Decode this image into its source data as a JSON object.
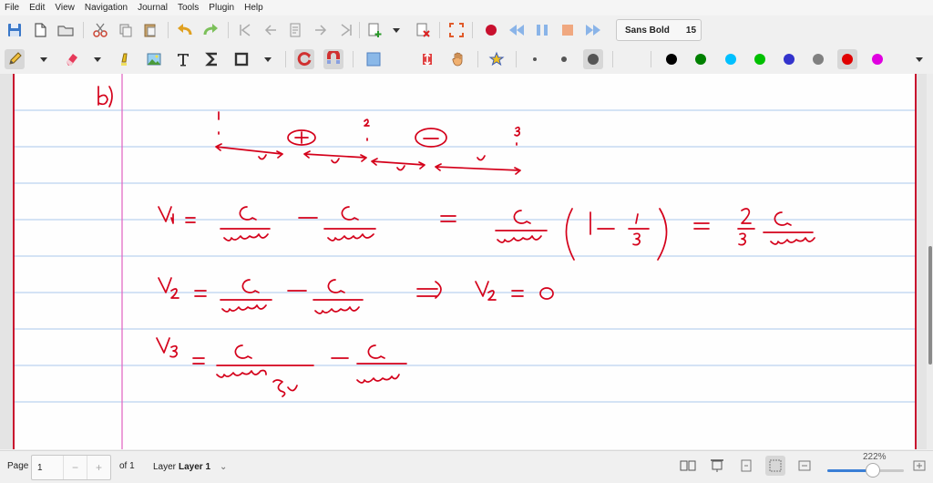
{
  "menu": [
    "File",
    "Edit",
    "View",
    "Navigation",
    "Journal",
    "Tools",
    "Plugin",
    "Help"
  ],
  "font_selector": {
    "name": "Sans Bold",
    "size": "15"
  },
  "colors": {
    "pen_palette": [
      "#000000",
      "#008000",
      "#00c0ff",
      "#00c000",
      "#3333cc",
      "#808080",
      "#e00000",
      "#e000e0"
    ],
    "ink": "#d4001a",
    "rule_line": "#a9c8ec",
    "margin_line": "#c8102e"
  },
  "notes": {
    "part": "b)",
    "eq1": "V₁ = Q/(4πε₀ r) − Q/(4πε₀ 3r) = Q/(4πε₀ r)(1 − 1/3) = 2/3 · Q/(4πε₀ r)",
    "eq2": "V₂ = Q/(4πε₀ r) − Q/(4πε₀ r) ⇒ V₂ = 0",
    "eq3": "V₃ = Q/(4πε₀ 3r) − Q/(4πε₀ r)"
  },
  "statusbar": {
    "page_label": "Page",
    "page_value": "1",
    "of_label": "of 1",
    "layer_label": "Layer",
    "layer_value": "Layer 1",
    "zoom": "222%",
    "zoom_fraction": 0.6
  }
}
